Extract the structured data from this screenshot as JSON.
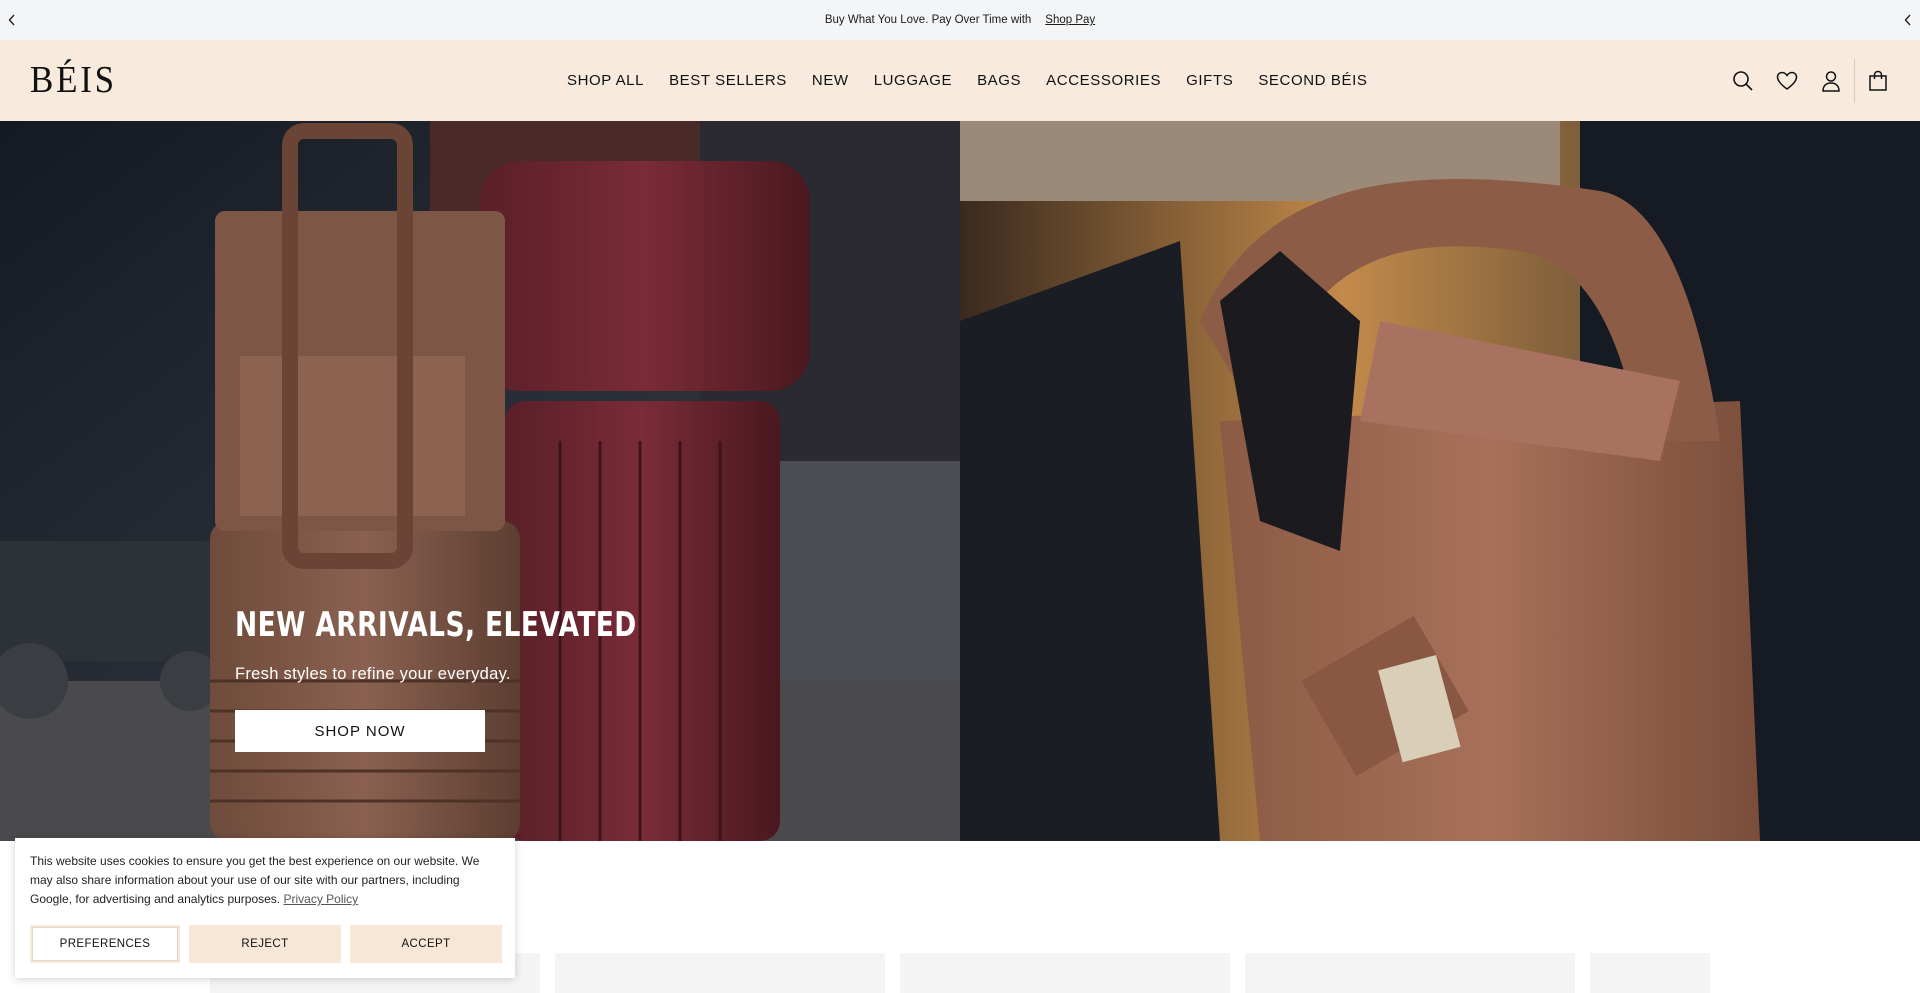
{
  "announcement": {
    "text": "Buy What You Love. Pay Over Time with",
    "link": "Shop Pay",
    "prev_icon": "chevron-left-icon",
    "next_icon": "chevron-left-icon"
  },
  "header": {
    "logo": "BÉIS",
    "nav": [
      "SHOP ALL",
      "BEST SELLERS",
      "NEW",
      "LUGGAGE",
      "BAGS",
      "ACCESSORIES",
      "GIFTS",
      "SECOND BÉIS"
    ],
    "icons": [
      "search-icon",
      "heart-icon",
      "account-icon",
      "bag-icon"
    ],
    "background": "#f8ebde"
  },
  "hero": {
    "title": "NEW ARRIVALS, ELEVATED",
    "subtitle": "Fresh styles to refine your everyday.",
    "cta": "SHOP NOW"
  },
  "cookie_banner": {
    "text": "This website uses cookies to ensure you get the best experience on our website. We may also share information about your use of our site with our partners, including Google, for advertising and analytics purposes.",
    "link": "Privacy Policy",
    "buttons": {
      "preferences": "PREFERENCES",
      "reject": "REJECT",
      "accept": "ACCEPT"
    }
  },
  "colors": {
    "accent": "#f7e7d6",
    "announcement_bg": "#f4f5f7"
  }
}
